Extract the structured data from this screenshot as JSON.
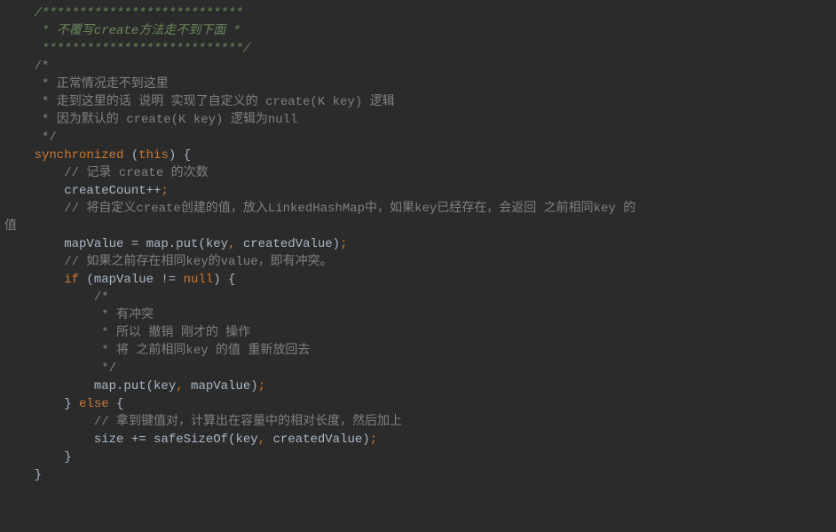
{
  "code": {
    "l1": "    /***************************",
    "l2": "     * 不覆写create方法走不到下面 *",
    "l3": "     ***************************/",
    "l4": "    /*",
    "l5": "     * 正常情况走不到这里",
    "l6": "     * 走到这里的话 说明 实现了自定义的 create(K key) 逻辑",
    "l7": "     * 因为默认的 create(K key) 逻辑为null",
    "l8": "     */",
    "kw_sync": "    synchronized",
    "kw_this": "this",
    "paren_open": " (",
    "paren_close": ") {",
    "l10": "        // 记录 create 的次数",
    "l11a": "        createCount++",
    "l11b": ";",
    "l12": "        // 将自定义create创建的值，放入LinkedHashMap中，如果key已经存在，会返回 之前相同key 的",
    "l12b": "值",
    "l14a": "        mapValue = map.put(key",
    "comma": ",",
    "l14b": " createdValue)",
    "semi": ";",
    "blank": "",
    "l16": "        // 如果之前存在相同key的value，即有冲突。",
    "l17_if": "        if",
    "l17_a": " (mapValue != ",
    "l17_null": "null",
    "l17_b": ") {",
    "l18": "            /*",
    "l19": "             * 有冲突",
    "l20": "             * 所以 撤销 刚才的 操作",
    "l21": "             * 将 之前相同key 的值 重新放回去",
    "l22": "             */",
    "l23a": "            map.put(key",
    "l23b": " mapValue)",
    "l24_else": "        } else {",
    "l24_kw_else": "else",
    "l24_pre": "        } ",
    "l24_post": " {",
    "l25": "            // 拿到键值对，计算出在容量中的相对长度，然后加上",
    "l26a": "            size += safeSizeOf(key",
    "l26b": " createdValue)",
    "l27": "        }",
    "l28": "    }"
  }
}
